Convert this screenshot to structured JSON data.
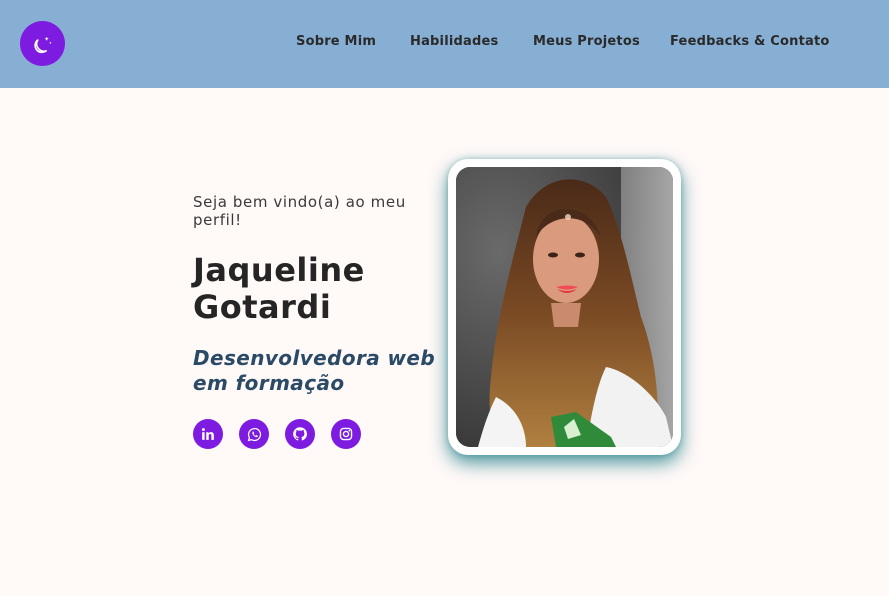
{
  "header": {
    "background": "#87afd4",
    "theme_toggle": {
      "icon": "moon-stars-icon",
      "color": "#7e1be0"
    },
    "nav": [
      {
        "label": "Sobre Mim"
      },
      {
        "label": "Habilidades"
      },
      {
        "label": "Meus Projetos"
      },
      {
        "label": "Feedbacks & Contato"
      }
    ]
  },
  "hero": {
    "greeting": "Seja bem vindo(a) ao meu perfil!",
    "name": "Jaqueline Gotardi",
    "role": "Desenvolvedora web em formação",
    "socials": [
      {
        "icon": "linkedin-icon"
      },
      {
        "icon": "whatsapp-icon"
      },
      {
        "icon": "github-icon"
      },
      {
        "icon": "instagram-icon"
      }
    ],
    "photo": {
      "icon": "profile-photo"
    }
  },
  "colors": {
    "accent": "#7e1be0",
    "header": "#87afd4",
    "background": "#fff9f8",
    "role_text": "#2a4a66",
    "photo_glow": "#14787f"
  }
}
